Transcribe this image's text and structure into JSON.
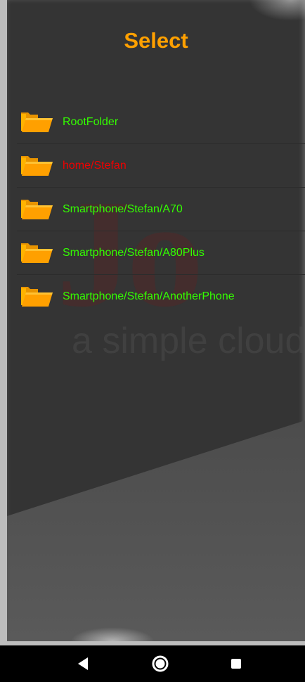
{
  "header": {
    "title": "Select"
  },
  "colors": {
    "title": "#ffa000",
    "normal_item": "#33ff00",
    "selected_item": "#ee0000",
    "background": "#343434",
    "folder": "#ffa000"
  },
  "watermark": {
    "logo_text": "Jo",
    "tagline": "a simple cloud"
  },
  "folders": [
    {
      "label": "RootFolder",
      "color": "#33ff00",
      "icon": "folder-open-icon"
    },
    {
      "label": "home/Stefan",
      "color": "#ee0000",
      "icon": "folder-open-icon"
    },
    {
      "label": "Smartphone/Stefan/A70",
      "color": "#33ff00",
      "icon": "folder-open-icon"
    },
    {
      "label": "Smartphone/Stefan/A80Plus",
      "color": "#33ff00",
      "icon": "folder-open-icon"
    },
    {
      "label": "Smartphone/Stefan/AnotherPhone",
      "color": "#33ff00",
      "icon": "folder-open-icon"
    }
  ],
  "navbar": {
    "back_icon": "back-triangle-icon",
    "home_icon": "home-circle-icon",
    "recents_icon": "recents-square-icon"
  }
}
